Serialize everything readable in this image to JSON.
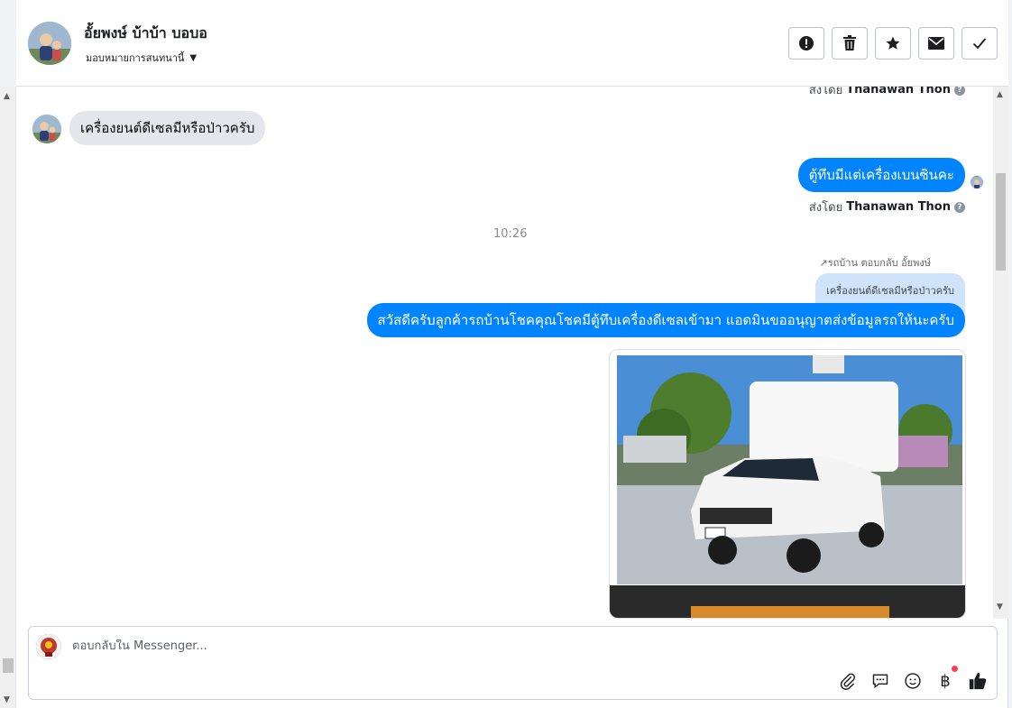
{
  "header": {
    "contact_name": "อั้ยพงษ์ บ้าบ้า บอบอ",
    "assign_label": "มอบหมายการสนทนานี้"
  },
  "chat": {
    "sent_by_prefix": "ส่งโดย",
    "sent_by_name_top": "Thanawan Thon",
    "incoming_message": "เครื่องยนต์ดีเซลมีหรือป่าวครับ",
    "outgoing_message_1": "ตู้ทึบมีแต่เครื่องเบนซินคะ",
    "sent_by_name_1": "Thanawan Thon",
    "timestamp": "10:26",
    "reply_label": "รถบ้าน ตอบกลับ อั้ยพงษ์",
    "quoted_text": "เครื่องยนต์ดีเซลมีหรือป่าวครับ",
    "outgoing_message_2": "สวัสดีครับลูกค้ารถบ้านโชคคุณโชคมีตู้ทึบเครื่องดีเซลเข้ามา แอดมินขออนุญาตส่งข้อมูลรถให้นะครับ",
    "photo_plate": "5ฒ 1675"
  },
  "composer": {
    "placeholder": "ตอบกลับใน Messenger..."
  },
  "icons": {
    "actions": [
      "alert-icon",
      "trash-icon",
      "star-icon",
      "envelope-icon",
      "check-icon"
    ],
    "tools": [
      "attachment-icon",
      "saved-reply-icon",
      "emoji-icon",
      "baht-payment-icon",
      "like-icon"
    ]
  },
  "colors": {
    "outgoing_bubble": "#0084ff",
    "incoming_bubble": "#e4e6eb",
    "quoted_bubble": "#cfe3fb",
    "notification_dot": "#fa3e5b"
  }
}
